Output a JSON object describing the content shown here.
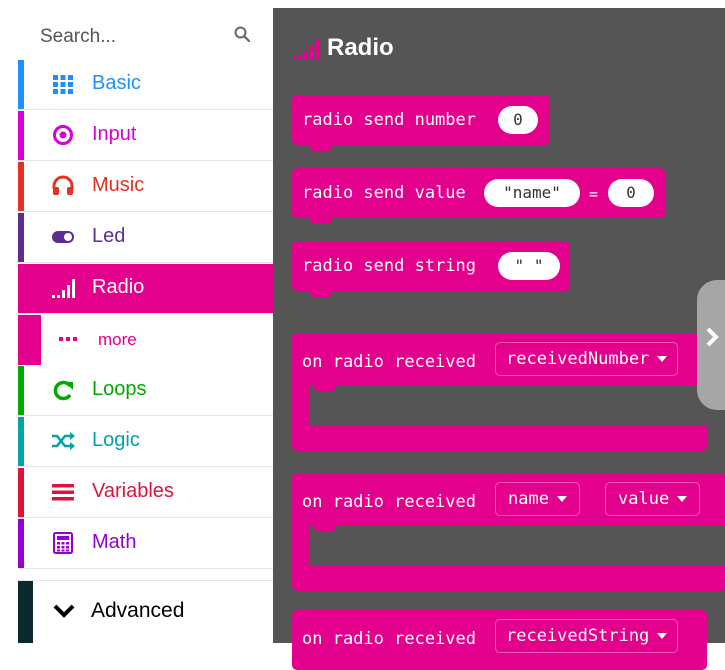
{
  "search": {
    "placeholder": "Search..."
  },
  "categories": [
    {
      "label": "Basic",
      "color": "#1e90ff",
      "icon": "grid-icon"
    },
    {
      "label": "Input",
      "color": "#d400d4",
      "icon": "target-icon"
    },
    {
      "label": "Music",
      "color": "#e63022",
      "icon": "headphones-icon"
    },
    {
      "label": "Led",
      "color": "#5c2d91",
      "icon": "toggle-icon"
    },
    {
      "label": "Radio",
      "color": "#e3008c",
      "icon": "signal-bars-icon",
      "selected": true
    },
    {
      "label": "more",
      "color": "#e3008c",
      "icon": "ellipsis-icon"
    },
    {
      "label": "Loops",
      "color": "#00aa00",
      "icon": "loop-arrow-icon"
    },
    {
      "label": "Logic",
      "color": "#00a4a6",
      "icon": "shuffle-icon"
    },
    {
      "label": "Variables",
      "color": "#dc143c",
      "icon": "list-lines-icon"
    },
    {
      "label": "Math",
      "color": "#9400d3",
      "icon": "calculator-icon"
    }
  ],
  "advanced": {
    "label": "Advanced",
    "icon": "chevron-down-icon"
  },
  "flyout": {
    "title": "Radio",
    "title_icon": "signal-bars-icon",
    "blocks": [
      {
        "text": "radio send number",
        "pill": "0"
      },
      {
        "text": "radio send value",
        "pill1": "\"name\"",
        "eq": "=",
        "pill2": "0"
      },
      {
        "text": "radio send string",
        "pill": "\" \""
      },
      {
        "text": "on radio received",
        "dropdown": "receivedNumber"
      },
      {
        "text": "on radio received",
        "dropdown1": "name",
        "dropdown2": "value"
      },
      {
        "text": "on radio received",
        "dropdown": "receivedString"
      }
    ]
  },
  "colors": {
    "radio": "#e3008c",
    "flyout_bg": "#555555"
  }
}
